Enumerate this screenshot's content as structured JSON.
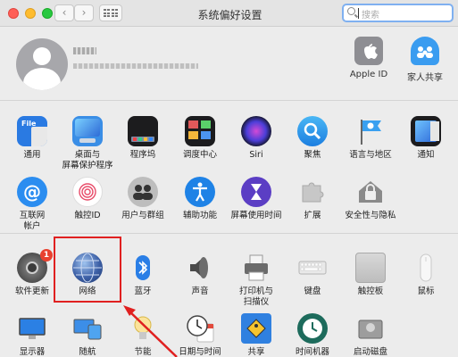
{
  "window": {
    "title": "系统偏好设置",
    "search_placeholder": "搜索"
  },
  "account": {
    "items": [
      {
        "label": "Apple ID",
        "icon": "apple-icon"
      },
      {
        "label": "家人共享",
        "icon": "family-sharing-icon"
      }
    ]
  },
  "prefs_row1": [
    {
      "label": "通用",
      "icon": "general-icon"
    },
    {
      "label": "桌面与\n屏幕保护程序",
      "icon": "desktop-screensaver-icon"
    },
    {
      "label": "程序坞",
      "icon": "dock-icon"
    },
    {
      "label": "调度中心",
      "icon": "mission-control-icon"
    },
    {
      "label": "Siri",
      "icon": "siri-icon"
    },
    {
      "label": "聚焦",
      "icon": "spotlight-icon"
    },
    {
      "label": "语言与地区",
      "icon": "language-region-icon"
    },
    {
      "label": "通知",
      "icon": "notifications-icon"
    }
  ],
  "prefs_row2": [
    {
      "label": "互联网\n帐户",
      "icon": "internet-accounts-icon"
    },
    {
      "label": "触控ID",
      "icon": "touch-id-icon"
    },
    {
      "label": "用户与群组",
      "icon": "users-groups-icon"
    },
    {
      "label": "辅助功能",
      "icon": "accessibility-icon"
    },
    {
      "label": "屏幕使用时间",
      "icon": "screen-time-icon"
    },
    {
      "label": "扩展",
      "icon": "extensions-icon"
    },
    {
      "label": "安全性与隐私",
      "icon": "security-privacy-icon"
    }
  ],
  "prefs_row3": [
    {
      "label": "软件更新",
      "icon": "software-update-icon",
      "badge": "1"
    },
    {
      "label": "网络",
      "icon": "network-icon"
    },
    {
      "label": "蓝牙",
      "icon": "bluetooth-icon"
    },
    {
      "label": "声音",
      "icon": "sound-icon"
    },
    {
      "label": "打印机与\n扫描仪",
      "icon": "printers-scanners-icon"
    },
    {
      "label": "键盘",
      "icon": "keyboard-icon"
    },
    {
      "label": "触控板",
      "icon": "trackpad-icon"
    },
    {
      "label": "鼠标",
      "icon": "mouse-icon"
    }
  ],
  "prefs_row4": [
    {
      "label": "显示器",
      "icon": "displays-icon"
    },
    {
      "label": "随航",
      "icon": "sidecar-icon"
    },
    {
      "label": "节能",
      "icon": "energy-saver-icon"
    },
    {
      "label": "日期与时间",
      "icon": "date-time-icon"
    },
    {
      "label": "共享",
      "icon": "sharing-icon"
    },
    {
      "label": "时间机器",
      "icon": "time-machine-icon"
    },
    {
      "label": "启动磁盘",
      "icon": "startup-disk-icon"
    }
  ]
}
